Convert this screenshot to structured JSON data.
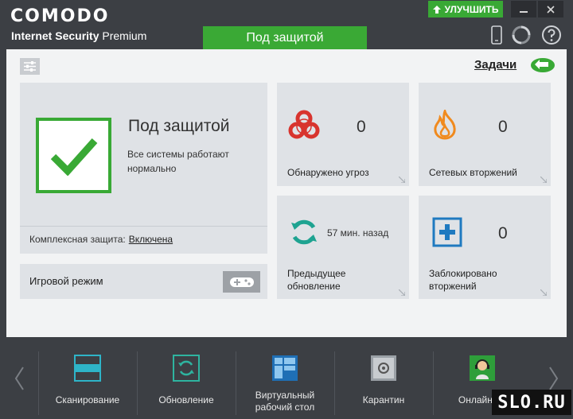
{
  "app": {
    "logo": "COMODO",
    "product_name": "Internet Security",
    "product_edition": "Premium",
    "upgrade_label": "УЛУЧШИТЬ",
    "status_tab": "Под защитой",
    "accent_color": "#39a935"
  },
  "toolbar": {
    "tasks_label": "Задачи"
  },
  "summary": {
    "state": "Под защитой",
    "description": "Все системы работают нормально",
    "protection_label": "Комплексная защита:",
    "protection_value": "Включена"
  },
  "game_mode": {
    "label": "Игровой режим"
  },
  "tiles": [
    {
      "value": "0",
      "caption": "Обнаружено угроз",
      "icon": "biohazard-icon"
    },
    {
      "value": "0",
      "caption": "Сетевых вторжений",
      "icon": "fire-icon"
    },
    {
      "value": "57 мин. назад",
      "caption": "Предыдущее обновление",
      "icon": "refresh-icon"
    },
    {
      "value": "0",
      "caption": "Заблокировано вторжений",
      "icon": "plus-box-icon"
    }
  ],
  "bottom_tasks": [
    {
      "label": "Сканирование",
      "icon": "scan-icon"
    },
    {
      "label": "Обновление",
      "icon": "update-icon"
    },
    {
      "label": "Виртуальный рабочий стол",
      "icon": "virtual-desktop-icon"
    },
    {
      "label": "Карантин",
      "icon": "quarantine-icon"
    },
    {
      "label": "Онлайн-по",
      "icon": "support-agent-icon"
    }
  ],
  "watermark": "SLO.RU"
}
